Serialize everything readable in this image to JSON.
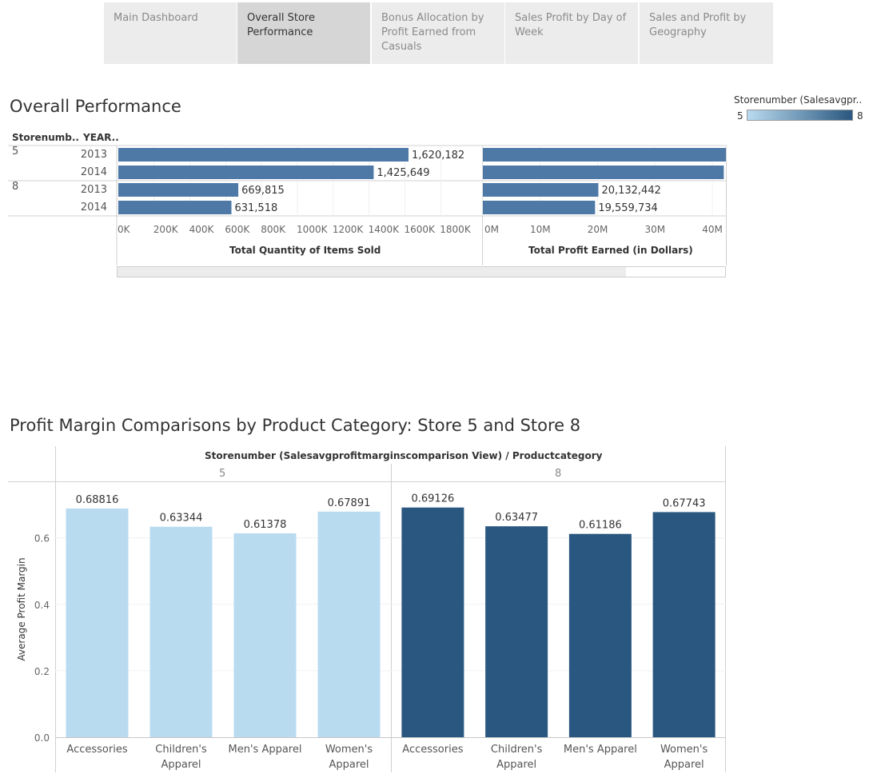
{
  "tabs": [
    {
      "label": "Main Dashboard",
      "active": false
    },
    {
      "label": "Overall Store Performance",
      "active": true
    },
    {
      "label": "Bonus Allocation by Profit Earned from Casuals",
      "active": false
    },
    {
      "label": "Sales Profit by Day of Week",
      "active": false
    },
    {
      "label": "Sales and Profit by Geography",
      "active": false
    }
  ],
  "legend": {
    "title": "Storenumber (Salesavgpr..",
    "min_label": "5",
    "max_label": "8",
    "color_low": "#b9dbf0",
    "color_high": "#2a5780"
  },
  "colors": {
    "bar_top": "#4e79a7",
    "store5": "#b9dbf0",
    "store8": "#2a5780"
  },
  "overall": {
    "title": "Overall Performance",
    "row_header_store": "Storenumb..",
    "row_header_year": "YEAR..",
    "qty_axis_title": "Total Quantity of Items Sold",
    "profit_axis_title": "Total Profit Earned (in Dollars)"
  },
  "chart_data": [
    {
      "type": "bar",
      "orientation": "horizontal",
      "title": "Overall Performance",
      "xlabel": "Total Quantity of Items Sold",
      "rows": [
        {
          "store": "5",
          "year": "2013"
        },
        {
          "store": "",
          "year": "2014"
        },
        {
          "store": "8",
          "year": "2013"
        },
        {
          "store": "",
          "year": "2014"
        }
      ],
      "values": [
        1620182,
        1425649,
        669815,
        631518
      ],
      "value_labels": [
        "1,620,182",
        "1,425,649",
        "669,815",
        "631,518"
      ],
      "ticks": [
        0,
        200000,
        400000,
        600000,
        800000,
        1000000,
        1200000,
        1400000,
        1600000,
        1800000
      ],
      "tick_labels": [
        "0K",
        "200K",
        "400K",
        "600K",
        "800K",
        "1000K",
        "1200K",
        "1400K",
        "1600K",
        "1800K"
      ],
      "xlim": [
        0,
        1950000
      ],
      "grid": true
    },
    {
      "type": "bar",
      "orientation": "horizontal",
      "xlabel": "Total Profit Earned (in Dollars)",
      "values": [
        48000000,
        42000000,
        20132442,
        19559734
      ],
      "value_labels": [
        "",
        "",
        "20,132,442",
        "19,559,734"
      ],
      "ticks": [
        0,
        10000000,
        20000000,
        30000000,
        40000000
      ],
      "tick_labels": [
        "0M",
        "10M",
        "20M",
        "30M",
        "40M"
      ],
      "xlim": [
        0,
        41000000
      ],
      "grid": true
    },
    {
      "type": "bar",
      "title": "Profit Margin Comparisons by Product Category: Store 5 and Store 8",
      "header": "Storenumber (Salesavgprofitmarginscomparison View) / Productcategory",
      "ylabel": "Average Profit Margin",
      "ylim": [
        0,
        0.75
      ],
      "yticks": [
        0.0,
        0.2,
        0.4,
        0.6
      ],
      "ytick_labels": [
        "0.0",
        "0.2",
        "0.4",
        "0.6"
      ],
      "grid": true,
      "panels": [
        {
          "store": "5",
          "categories": [
            "Accessories",
            "Children's Apparel",
            "Men's Apparel",
            "Women's Apparel"
          ],
          "category_lines": [
            [
              "Accessories"
            ],
            [
              "Children's",
              "Apparel"
            ],
            [
              "Men's Apparel"
            ],
            [
              "Women's",
              "Apparel"
            ]
          ],
          "values": [
            0.68816,
            0.63344,
            0.61378,
            0.67891
          ],
          "value_labels": [
            "0.68816",
            "0.63344",
            "0.61378",
            "0.67891"
          ]
        },
        {
          "store": "8",
          "categories": [
            "Accessories",
            "Children's Apparel",
            "Men's Apparel",
            "Women's Apparel"
          ],
          "category_lines": [
            [
              "Accessories"
            ],
            [
              "Children's",
              "Apparel"
            ],
            [
              "Men's Apparel"
            ],
            [
              "Women's",
              "Apparel"
            ]
          ],
          "values": [
            0.69126,
            0.63477,
            0.61186,
            0.67743
          ],
          "value_labels": [
            "0.69126",
            "0.63477",
            "0.61186",
            "0.67743"
          ]
        }
      ]
    }
  ]
}
